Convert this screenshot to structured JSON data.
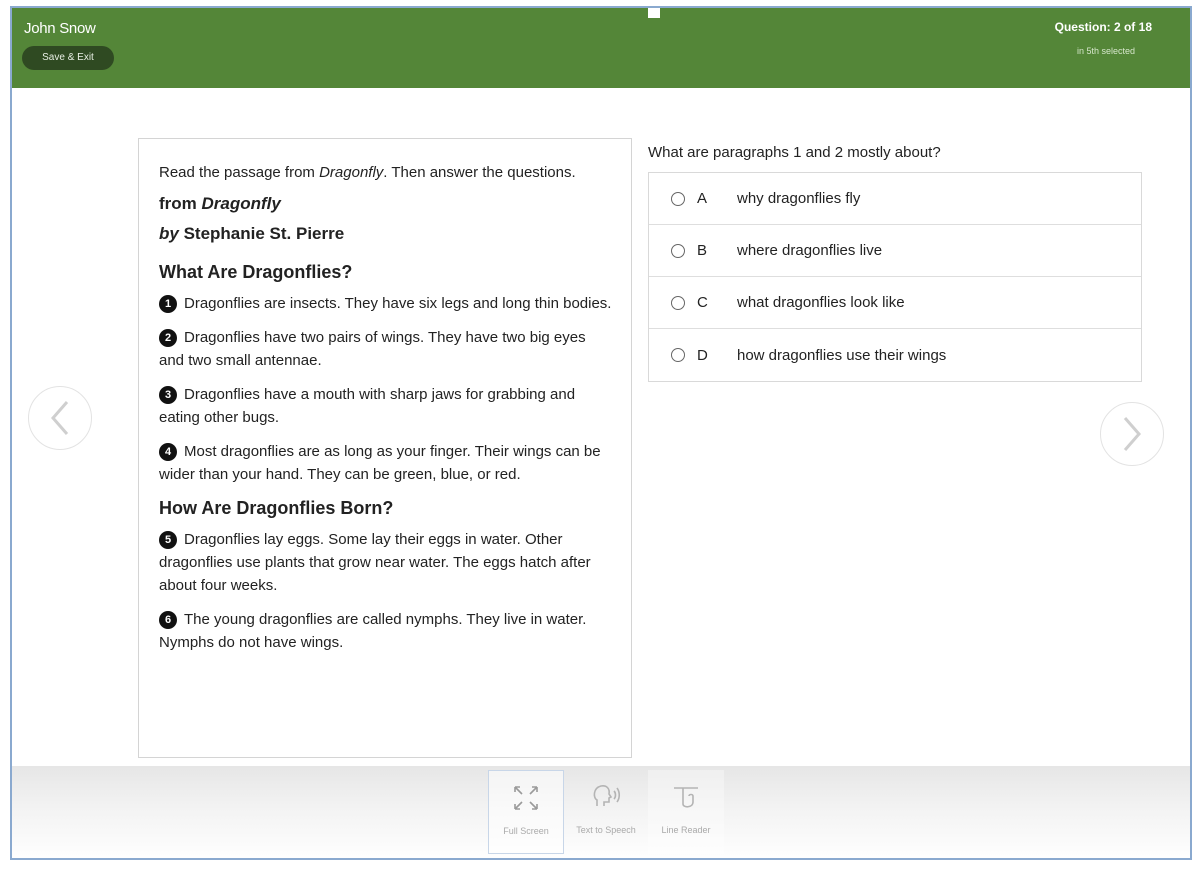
{
  "header": {
    "student_name": "John Snow",
    "save_exit_label": "Save & Exit",
    "question_counter": "Question: 2 of 18",
    "question_sub": "in 5th selected",
    "bar_color": "#548638"
  },
  "passage": {
    "intro_a": "Read the passage from ",
    "intro_title": "Dragonfly",
    "intro_b": ". Then answer the questions.",
    "source_title": "from Dragonfly",
    "source_author": "by Stephanie St. Pierre",
    "heading1": "What Are Dragonflies?",
    "heading2": "How Are Dragonflies Born?",
    "paragraphs": [
      {
        "num": "1",
        "text": "Dragonflies are insects. They have six legs and long thin bodies."
      },
      {
        "num": "2",
        "text": "Dragonflies have two pairs of wings. They have two big eyes and two small antennae."
      },
      {
        "num": "3",
        "text": "Dragonflies have a mouth with sharp jaws for grabbing and eating other bugs."
      },
      {
        "num": "4",
        "text": "Most dragonflies are as long as your finger. Their wings can be wider than your hand. They can be green, blue, or red."
      },
      {
        "num": "5",
        "text": "Dragonflies lay eggs. Some lay their eggs in water. Other dragonflies use plants that grow near water. The eggs hatch after about four weeks."
      },
      {
        "num": "6",
        "text": "The young dragonflies are called nymphs. They live in water. Nymphs do not have wings."
      }
    ]
  },
  "question": {
    "prompt": "What are paragraphs 1 and 2 mostly about?",
    "options": [
      {
        "letter": "A",
        "text": "why dragonflies fly"
      },
      {
        "letter": "B",
        "text": "where dragonflies live"
      },
      {
        "letter": "C",
        "text": "what dragonflies look like"
      },
      {
        "letter": "D",
        "text": "how dragonflies use their wings"
      }
    ]
  },
  "tools": {
    "full_screen": "Full Screen",
    "text_to_speech": "Text to Speech",
    "line_reader": "Line Reader"
  },
  "icons": {
    "prev": "chevron-left-icon",
    "next": "chevron-right-icon",
    "full_screen": "expand-arrows-icon",
    "tts": "speaking-head-icon",
    "line_reader": "line-reader-icon"
  }
}
